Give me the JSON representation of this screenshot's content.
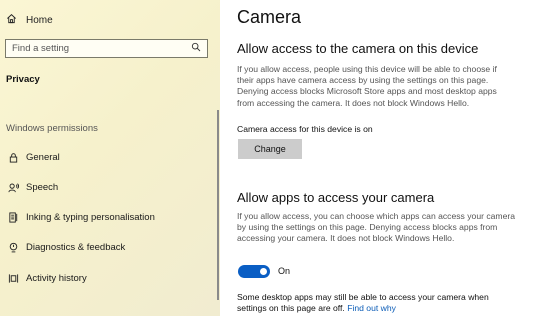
{
  "sidebar": {
    "home_label": "Home",
    "search_placeholder": "Find a setting",
    "category": "Privacy",
    "section_label": "Windows permissions",
    "items": [
      {
        "label": "General",
        "icon": "lock-icon"
      },
      {
        "label": "Speech",
        "icon": "speech-icon"
      },
      {
        "label": "Inking & typing personalisation",
        "icon": "inking-icon"
      },
      {
        "label": "Diagnostics & feedback",
        "icon": "diagnostics-icon"
      },
      {
        "label": "Activity history",
        "icon": "activity-history-icon"
      }
    ]
  },
  "main": {
    "title": "Camera",
    "device_section": {
      "heading": "Allow access to the camera on this device",
      "desc_lines": [
        "If you allow access, people using this device will be able to choose if",
        "their apps have camera access by using the settings on this page.",
        "Denying access blocks Microsoft Store apps and most desktop apps",
        "from accessing the camera. It does not block Windows Hello."
      ],
      "status": "Camera access for this device is on",
      "button_label": "Change"
    },
    "apps_section": {
      "heading": "Allow apps to access your camera",
      "desc_lines": [
        "If you allow access, you can choose which apps can access your camera",
        "by using the settings on this page. Denying access blocks apps from",
        "accessing your camera. It does not block Windows Hello."
      ],
      "toggle_state": "On",
      "note_line1": "Some desktop apps may still be able to access your camera when",
      "note_line2_prefix": "settings on this page are off.",
      "note_link": "Find out why"
    }
  },
  "colors": {
    "sidebar_bg": "#f6f1cc",
    "accent": "#0a5ec4",
    "link": "#0b5cb7",
    "button_bg": "#cccccc"
  }
}
